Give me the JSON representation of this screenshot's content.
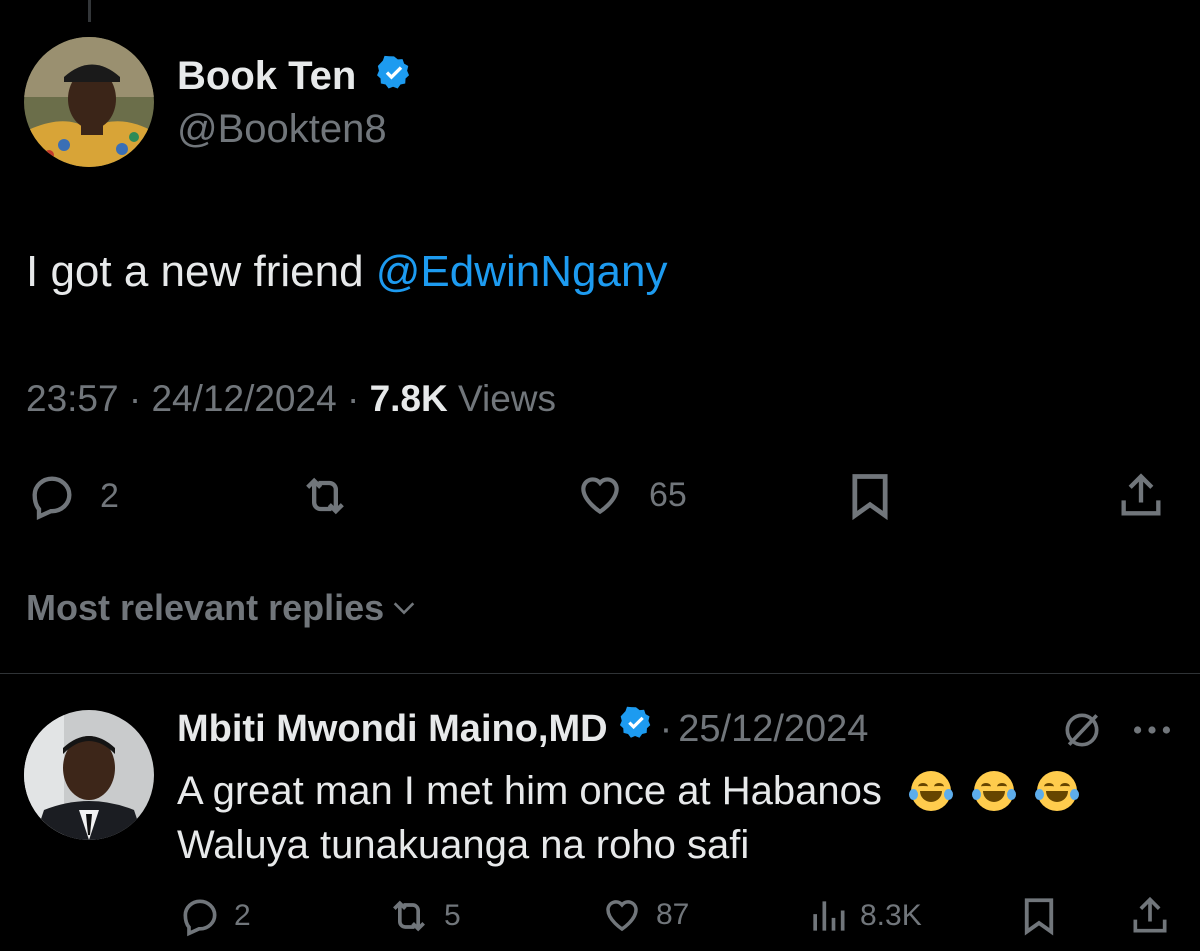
{
  "tweet": {
    "author": {
      "name": "Book Ten",
      "handle": "@Bookten8"
    },
    "text_prefix": "I got a new friend ",
    "mention": "@EdwinNgany",
    "time": "23:57",
    "date": "24/12/2024",
    "views_count": "7.8K",
    "views_label": "Views",
    "stats": {
      "replies": "2",
      "likes": "65"
    }
  },
  "replies_filter": {
    "label": "Most relevant replies"
  },
  "reply": {
    "author": {
      "name": "Mbiti Mwondi Maino,MD"
    },
    "date": "25/12/2024",
    "line1": "A great man I met him once at Habanos",
    "line2": "Waluya tunakuanga na roho safi",
    "stats": {
      "replies": "2",
      "retweets": "5",
      "likes": "87",
      "views": "8.3K"
    }
  },
  "colors": {
    "background": "#000000",
    "text": "#e7e9ea",
    "muted": "#71767b",
    "link": "#1d9bf0"
  }
}
